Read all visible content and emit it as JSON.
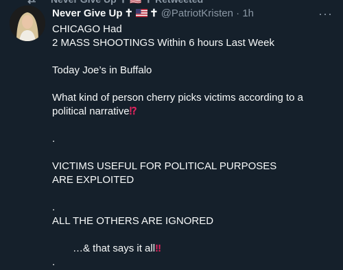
{
  "retweet_bar": {
    "icon": "retweet-icon",
    "text": "Never Give Up ✝ 🇺🇸 ✝ Retweeted"
  },
  "tweet": {
    "author_name": "Never Give Up",
    "cross_glyph": "✝",
    "flag": "us-flag-icon",
    "handle": "@PatriotKristen",
    "separator": "·",
    "time": "1h",
    "more_icon": "more-icon",
    "lines": {
      "l1": "CHICAGO Had",
      "l2": "2 MASS SHOOTINGS Within 6 hours Last Week",
      "l3": "Today Joe’s in Buffalo",
      "l4": "What kind of person cherry picks victims according to a",
      "l5": "political narrative",
      "l5_emoji": "⁉",
      "l6": ".",
      "l7": "VICTIMS USEFUL FOR POLITICAL PURPOSES",
      "l8": "ARE EXPLOITED",
      "l9": ".",
      "l10": "ALL THE OTHERS ARE IGNORED",
      "l11": "…& that says it all",
      "l11_emoji": "‼",
      "l12": "."
    }
  },
  "colors": {
    "background": "#15202b",
    "text": "#f7f9f9",
    "muted": "#8b98a5",
    "emoji_red": "#e0245e"
  }
}
